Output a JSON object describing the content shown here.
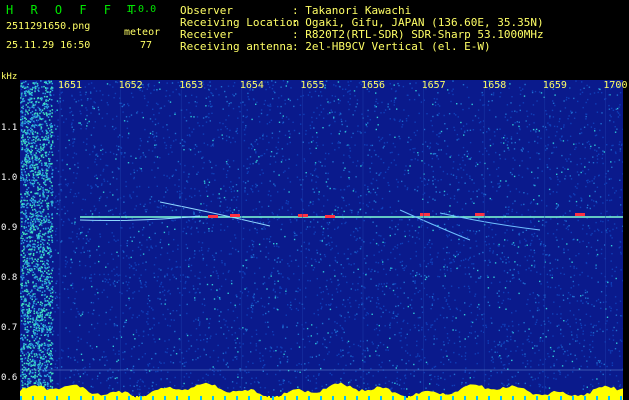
{
  "app": {
    "title": "H R O F F T",
    "version": "1.0.0"
  },
  "file": {
    "name": "2511291650.png",
    "datetime": "25.11.29 16:50"
  },
  "detection": {
    "label": "meteor",
    "count": "77"
  },
  "info": {
    "observer_label": "Observer",
    "observer": ": Takanori Kawachi",
    "location_label": "Receiving Location",
    "location": ": Ogaki, Gifu, JAPAN (136.60E, 35.35N)",
    "receiver_label": "Receiver",
    "receiver": ": R820T2(RTL-SDR) SDR-Sharp 53.1000MHz",
    "antenna_label": "Receiving antenna",
    "antenna": ": 2el-HB9CV Vertical (el. E-W)"
  },
  "axes": {
    "y_unit": "kHz",
    "y_ticks": [
      "1.1",
      "1.0",
      "0.9",
      "0.8",
      "0.7",
      "0.6"
    ],
    "x_ticks": [
      "1651",
      "1652",
      "1653",
      "1654",
      "1655",
      "1656",
      "1657",
      "1658",
      "1659",
      "1700"
    ]
  },
  "colors": {
    "background": "#0a1a8c",
    "trace": "#7fffd4",
    "level": "#ffff00",
    "text": "#ffff66"
  }
}
